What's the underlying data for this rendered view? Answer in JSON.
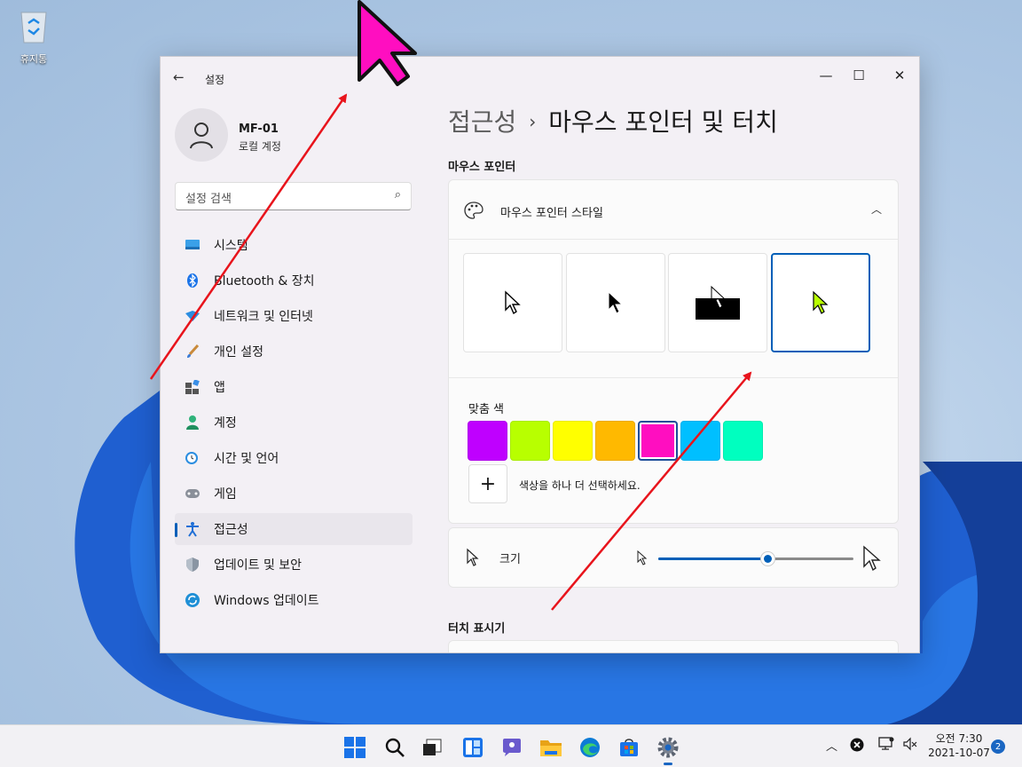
{
  "desktop": {
    "recycle_bin_label": "휴지통"
  },
  "window": {
    "title": "설정",
    "controls": {
      "minimize": "—",
      "maximize": "☐",
      "close": "✕"
    }
  },
  "profile": {
    "name": "MF-01",
    "account_type": "로컬 계정"
  },
  "search": {
    "placeholder": "설정 검색"
  },
  "sidebar": {
    "items": [
      {
        "label": "시스템",
        "icon": "system-icon"
      },
      {
        "label": "Bluetooth & 장치",
        "icon": "bluetooth-icon"
      },
      {
        "label": "네트워크 및 인터넷",
        "icon": "network-icon"
      },
      {
        "label": "개인 설정",
        "icon": "personalization-icon"
      },
      {
        "label": "앱",
        "icon": "apps-icon"
      },
      {
        "label": "계정",
        "icon": "accounts-icon"
      },
      {
        "label": "시간 및 언어",
        "icon": "time-language-icon"
      },
      {
        "label": "게임",
        "icon": "gaming-icon"
      },
      {
        "label": "접근성",
        "icon": "accessibility-icon",
        "active": true
      },
      {
        "label": "업데이트 및 보안",
        "icon": "shield-icon"
      },
      {
        "label": "Windows 업데이트",
        "icon": "windows-update-icon"
      }
    ]
  },
  "main": {
    "breadcrumb_parent": "접근성",
    "breadcrumb_sep": "›",
    "page_title": "마우스 포인터 및 터치",
    "section_mouse": "마우스 포인터",
    "pointer_style": {
      "label": "마우스 포인터 스타일",
      "selected_index": 3,
      "styles": [
        "white",
        "black",
        "inverted",
        "custom"
      ]
    },
    "custom_colors": {
      "label": "맞춤 색",
      "colors": [
        "#bf00ff",
        "#b8ff00",
        "#ffff00",
        "#ffb900",
        "#ff0ec0",
        "#00bfff",
        "#00ffbf"
      ],
      "selected_index": 4,
      "add_label": "색상을 하나 더 선택하세요.",
      "add_symbol": "+"
    },
    "size": {
      "label": "크기",
      "value_fraction": 0.56
    },
    "section_touch": "터치 표시기"
  },
  "taskbar": {
    "icons": [
      "start-icon",
      "search-icon",
      "task-view-icon",
      "widgets-icon",
      "chat-icon",
      "file-explorer-icon",
      "edge-icon",
      "store-icon",
      "settings-icon"
    ],
    "clock_time": "오전 7:30",
    "clock_date": "2021-10-07",
    "notification_count": "2"
  },
  "colors": {
    "accent": "#005fb8",
    "custom_pointer": "#b8ff00",
    "big_pointer": "#ff0ec0",
    "annotation_arrow": "#e8141c"
  }
}
